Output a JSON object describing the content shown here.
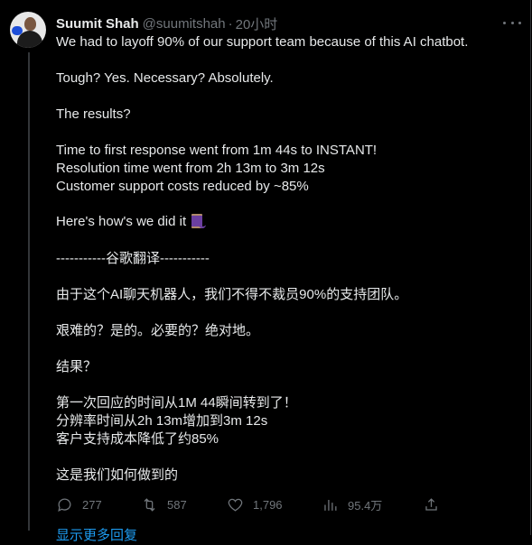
{
  "tweet": {
    "author_name": "Suumit Shah",
    "author_handle": "@suumitshah",
    "separator": "·",
    "time": "20小时",
    "lines": [
      "We had to layoff 90% of our support team because of this AI chatbot.",
      "Tough? Yes. Necessary? Absolutely.",
      "The results?",
      "Time to first response went from 1m 44s to INSTANT!",
      "Resolution time went from 2h 13m to 3m 12s",
      "Customer support costs reduced by ~85%",
      "Here's how's we did it",
      "-----------谷歌翻译-----------",
      "由于这个AI聊天机器人，我们不得不裁员90%的支持团队。",
      "艰难的？是的。必要的？绝对地。",
      "结果？",
      "第一次回应的时间从1M 44瞬间转到了！",
      "分辨率时间从2h 13m增加到3m 12s",
      "客户支持成本降低了约85%",
      "这是我们如何做到的"
    ],
    "thread_emoji_icon": "thread-spool-icon"
  },
  "actions": {
    "reply_count": "277",
    "retweet_count": "587",
    "like_count": "1,796",
    "views_count": "95.4万"
  },
  "show_more": "显示更多回复",
  "colors": {
    "background": "#000000",
    "text": "#e7e9ea",
    "muted": "#71767b",
    "link": "#1d9bf0"
  }
}
